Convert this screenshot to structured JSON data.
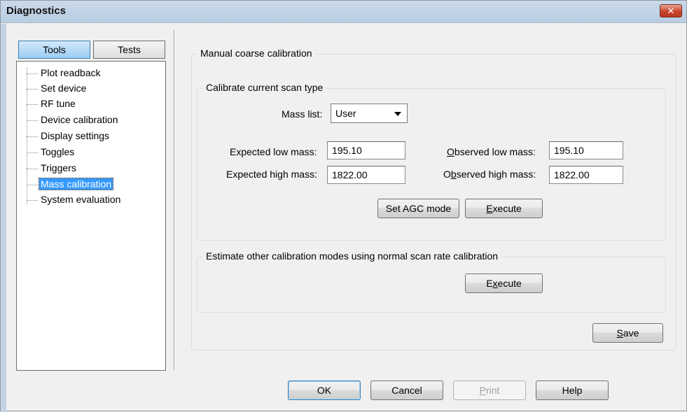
{
  "window": {
    "title": "Diagnostics",
    "close_label": "✕"
  },
  "tabs": {
    "tools": "Tools",
    "tests": "Tests"
  },
  "tree": {
    "items": [
      {
        "label": "Plot readback"
      },
      {
        "label": "Set device"
      },
      {
        "label": "RF tune"
      },
      {
        "label": "Device calibration"
      },
      {
        "label": "Display settings"
      },
      {
        "label": "Toggles"
      },
      {
        "label": "Triggers"
      },
      {
        "label": "Mass calibration",
        "selected": true
      },
      {
        "label": "System evaluation"
      }
    ]
  },
  "manual": {
    "legend": "Manual coarse calibration",
    "current": {
      "legend": "Calibrate current scan type",
      "mass_list_label": "Mass list:",
      "mass_list_value": "User",
      "expected_low_label": "Expected low mass:",
      "expected_low_value": "195.10",
      "expected_high_label": "Expected high mass:",
      "expected_high_value": "1822.00",
      "observed_low_label_pre": "",
      "observed_low_label_ul": "O",
      "observed_low_label_post": "bserved low mass:",
      "observed_low_value": "195.10",
      "observed_high_label_pre": "O",
      "observed_high_label_ul": "b",
      "observed_high_label_post": "served high mass:",
      "observed_high_value": "1822.00",
      "set_agc_label": "Set AGC mode",
      "execute_ul": "E",
      "execute_rest": "xecute"
    },
    "estimate": {
      "legend": "Estimate other calibration modes using normal scan rate calibration",
      "execute_pre": "E",
      "execute_ul": "x",
      "execute_post": "ecute"
    },
    "save_ul": "S",
    "save_rest": "ave"
  },
  "footer": {
    "ok": "OK",
    "cancel": "Cancel",
    "print_ul": "P",
    "print_rest": "rint",
    "help": "Help"
  }
}
